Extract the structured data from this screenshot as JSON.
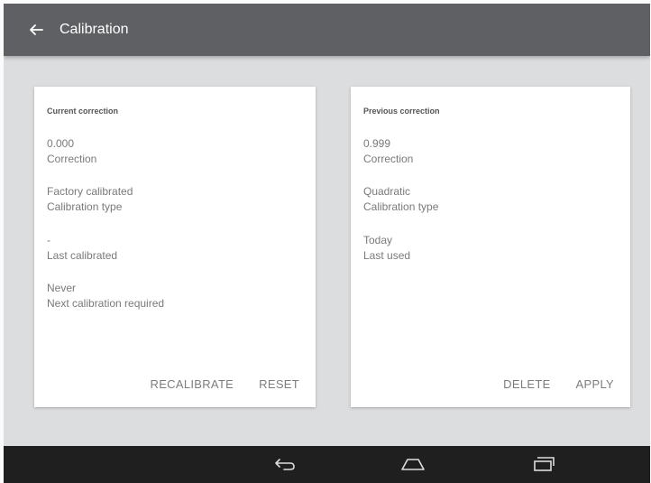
{
  "app_bar": {
    "title": "Calibration",
    "back_icon": "arrow-left-icon"
  },
  "current_card": {
    "header": "Current correction",
    "fields": [
      {
        "value": "0.000",
        "label": "Correction"
      },
      {
        "value": "Factory calibrated",
        "label": "Calibration type"
      },
      {
        "value": "-",
        "label": "Last calibrated"
      },
      {
        "value": "Never",
        "label": "Next calibration required"
      }
    ],
    "actions": {
      "recalibrate": "RECALIBRATE",
      "reset": "RESET"
    }
  },
  "previous_card": {
    "header": "Previous correction",
    "fields": [
      {
        "value": "0.999",
        "label": "Correction"
      },
      {
        "value": "Quadratic",
        "label": "Calibration type"
      },
      {
        "value": "Today",
        "label": "Last used"
      }
    ],
    "actions": {
      "delete": "DELETE",
      "apply": "APPLY"
    }
  },
  "nav_bar": {
    "icons": [
      "back-icon",
      "home-icon",
      "recents-icon"
    ]
  },
  "colors": {
    "app_bar": "#5f6063",
    "background": "#dcdddf",
    "card": "#ffffff",
    "nav_bar": "#1f1f1f"
  }
}
